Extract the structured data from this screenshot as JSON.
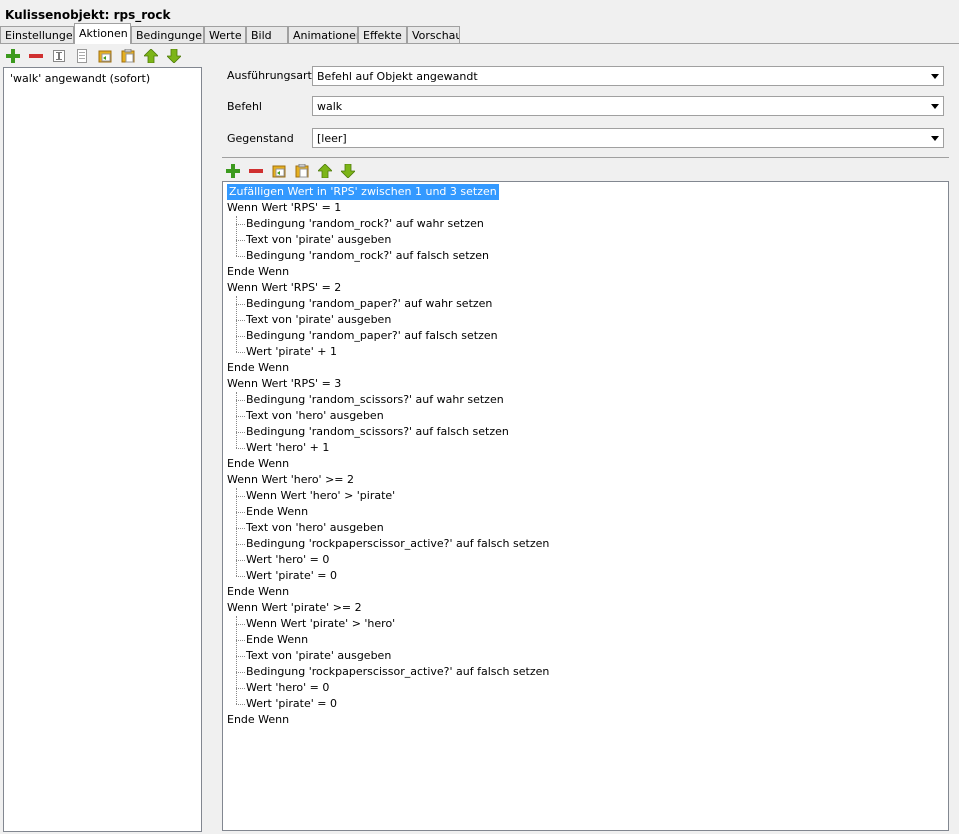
{
  "window": {
    "title": "Kulissenobjekt: rps_rock"
  },
  "tabs": [
    {
      "label": "Einstellungen",
      "active": false
    },
    {
      "label": "Aktionen",
      "active": true
    },
    {
      "label": "Bedingungen",
      "active": false
    },
    {
      "label": "Werte",
      "active": false
    },
    {
      "label": "Bild",
      "active": false
    },
    {
      "label": "Animationen",
      "active": false
    },
    {
      "label": "Effekte",
      "active": false
    },
    {
      "label": "Vorschau",
      "active": false
    }
  ],
  "left_toolbar": [
    "add-icon",
    "remove-icon",
    "rename-icon",
    "copy-icon",
    "paste-icon",
    "paste-special-icon",
    "move-up-icon",
    "move-down-icon"
  ],
  "action_list": [
    "'walk' angewandt (sofort)"
  ],
  "form": {
    "execution_label": "Ausführungsart",
    "execution_value": "Befehl auf Objekt angewandt",
    "command_label": "Befehl",
    "command_value": "walk",
    "item_label": "Gegenstand",
    "item_value": "[leer]"
  },
  "script_toolbar": [
    "add-icon",
    "remove-icon",
    "copy-icon",
    "paste-icon",
    "move-up-icon",
    "move-down-icon"
  ],
  "script_lines": [
    {
      "text": "Zufälligen Wert in 'RPS' zwischen 1 und 3 setzen",
      "indent": 0,
      "selected": true
    },
    {
      "text": "Wenn Wert 'RPS' = 1",
      "indent": 0
    },
    {
      "text": "Bedingung 'random_rock?' auf wahr setzen",
      "indent": 1
    },
    {
      "text": "Text von 'pirate' ausgeben",
      "indent": 1
    },
    {
      "text": "Bedingung 'random_rock?' auf falsch setzen",
      "indent": 1
    },
    {
      "text": "Ende Wenn",
      "indent": 0
    },
    {
      "text": "Wenn Wert 'RPS' = 2",
      "indent": 0
    },
    {
      "text": "Bedingung 'random_paper?' auf wahr setzen",
      "indent": 1
    },
    {
      "text": "Text von 'pirate' ausgeben",
      "indent": 1
    },
    {
      "text": "Bedingung 'random_paper?' auf falsch setzen",
      "indent": 1
    },
    {
      "text": "Wert 'pirate' + 1",
      "indent": 1
    },
    {
      "text": "Ende Wenn",
      "indent": 0
    },
    {
      "text": "Wenn Wert 'RPS' = 3",
      "indent": 0
    },
    {
      "text": "Bedingung 'random_scissors?' auf wahr setzen",
      "indent": 1
    },
    {
      "text": "Text von 'hero' ausgeben",
      "indent": 1
    },
    {
      "text": "Bedingung 'random_scissors?' auf falsch setzen",
      "indent": 1
    },
    {
      "text": "Wert 'hero' + 1",
      "indent": 1
    },
    {
      "text": "Ende Wenn",
      "indent": 0
    },
    {
      "text": "Wenn Wert 'hero' >= 2",
      "indent": 0
    },
    {
      "text": "Wenn Wert 'hero' > 'pirate'",
      "indent": 1
    },
    {
      "text": "Ende Wenn",
      "indent": 1
    },
    {
      "text": "Text von 'hero' ausgeben",
      "indent": 1
    },
    {
      "text": "Bedingung 'rockpaperscissor_active?' auf falsch setzen",
      "indent": 1
    },
    {
      "text": "Wert 'hero' = 0",
      "indent": 1
    },
    {
      "text": "Wert 'pirate' = 0",
      "indent": 1
    },
    {
      "text": "Ende Wenn",
      "indent": 0
    },
    {
      "text": "Wenn Wert 'pirate' >= 2",
      "indent": 0
    },
    {
      "text": "Wenn Wert 'pirate' > 'hero'",
      "indent": 1
    },
    {
      "text": "Ende Wenn",
      "indent": 1
    },
    {
      "text": "Text von 'pirate' ausgeben",
      "indent": 1
    },
    {
      "text": "Bedingung 'rockpaperscissor_active?' auf falsch setzen",
      "indent": 1
    },
    {
      "text": "Wert 'hero' = 0",
      "indent": 1
    },
    {
      "text": "Wert 'pirate' = 0",
      "indent": 1
    },
    {
      "text": "Ende Wenn",
      "indent": 0
    }
  ],
  "colors": {
    "selection": "#3399ff",
    "add": "#3c9a1e",
    "remove": "#d03030",
    "arrow": "#7cb518"
  }
}
